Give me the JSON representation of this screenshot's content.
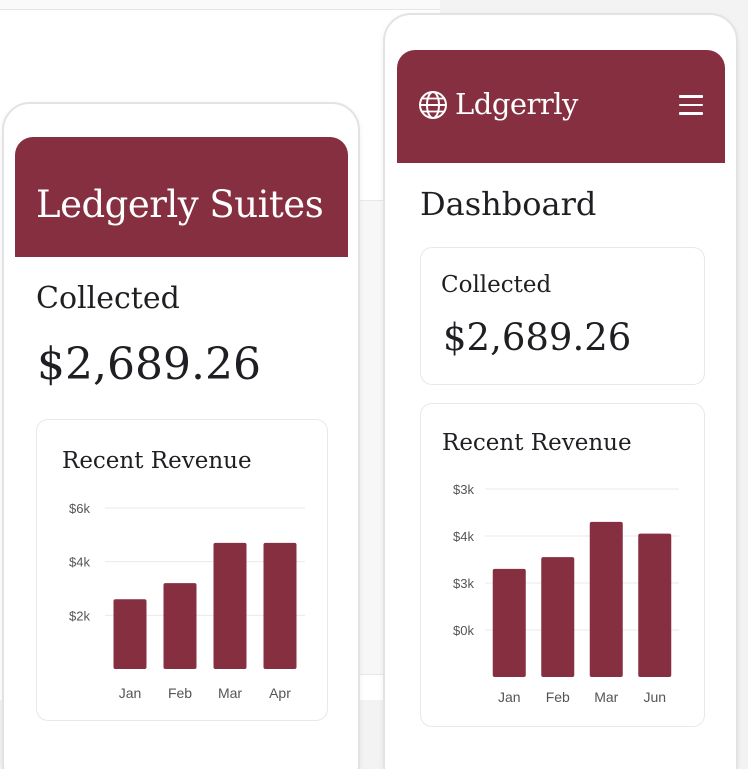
{
  "left_phone": {
    "header_title": "Ledgerly Suites",
    "collected_label": "Collected",
    "collected_amount": "$2,689.26",
    "chart_card_title": "Recent Revenue"
  },
  "right_phone": {
    "brand": "Ldgerrly",
    "page_title": "Dashboard",
    "collected_label": "Collected",
    "collected_amount": "$2,689.26",
    "chart_card_title": "Recent Revenue"
  },
  "colors": {
    "accent": "#862f41",
    "text": "#1f1f23",
    "muted": "#555555"
  },
  "icons": [
    "globe-icon",
    "hamburger-menu-icon"
  ],
  "chart_data": [
    {
      "type": "bar",
      "categories": [
        "Jan",
        "Feb",
        "Mar",
        "Apr"
      ],
      "values": [
        2.6,
        3.2,
        4.7,
        4.7
      ],
      "ytick_labels": [
        "$6k",
        "$4k",
        "$2k"
      ],
      "ytick_values": [
        6,
        4,
        2
      ],
      "ylim": [
        0,
        6
      ],
      "grid": true
    },
    {
      "type": "bar",
      "categories": [
        "Jan",
        "Feb",
        "Mar",
        "Jun"
      ],
      "values": [
        2.3,
        2.55,
        3.3,
        3.05
      ],
      "ytick_labels": [
        "$3k",
        "$4k",
        "$3k",
        "$0k"
      ],
      "ytick_values": [
        4,
        3,
        2,
        1
      ],
      "ylim": [
        0,
        4
      ],
      "grid": true
    }
  ]
}
